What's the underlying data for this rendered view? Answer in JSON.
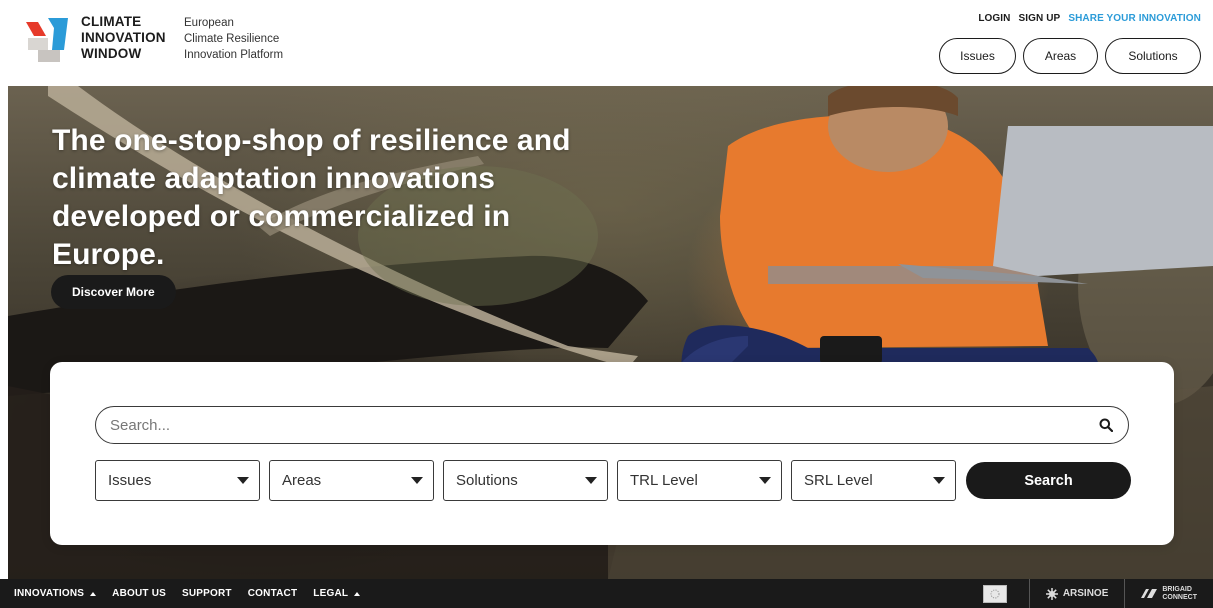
{
  "brand": {
    "lines": [
      "CLIMATE",
      "INNOVATION",
      "WINDOW"
    ],
    "tagline": [
      "European",
      "Climate Resilience",
      "Innovation Platform"
    ],
    "colors": {
      "red": "#e63a2a",
      "blue": "#2b9bd8",
      "grey": "#c8c4c0"
    }
  },
  "toplinks": {
    "login": "LOGIN",
    "signup": "SIGN UP",
    "share": "SHARE YOUR INNOVATION",
    "accent_color": "#2b9bd8"
  },
  "navpills": {
    "issues": "Issues",
    "areas": "Areas",
    "solutions": "Solutions"
  },
  "hero": {
    "title": "The one-stop-shop of resilience and climate adaptation innovations developed or commercialized in Europe.",
    "cta": "Discover More"
  },
  "search": {
    "placeholder": "Search...",
    "filters": {
      "issues": "Issues",
      "areas": "Areas",
      "solutions": "Solutions",
      "trl": "TRL Level",
      "srl": "SRL Level"
    },
    "button": "Search"
  },
  "footer": {
    "nav": {
      "innovations": "INNOVATIONS",
      "about": "ABOUT US",
      "support": "SUPPORT",
      "contact": "CONTACT",
      "legal": "LEGAL"
    },
    "partners": {
      "arsinoe": "ARSINOE",
      "brigaid_line1": "BRIGAID",
      "brigaid_line2": "CONNECT"
    }
  },
  "icons": [
    "search-icon",
    "chevron-down-icon",
    "chevron-up-icon",
    "eu-flag-icon",
    "arsinoe-logo",
    "brigaid-logo"
  ]
}
